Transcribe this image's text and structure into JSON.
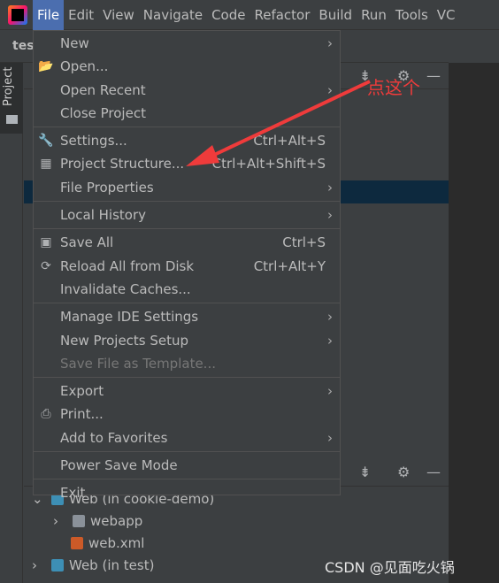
{
  "menubar": {
    "items": [
      "File",
      "Edit",
      "View",
      "Navigate",
      "Code",
      "Refactor",
      "Build",
      "Run",
      "Tools",
      "VC"
    ],
    "active": "File"
  },
  "tab_title": "tes",
  "tool_strip": {
    "label": "Project"
  },
  "file_menu": {
    "groups": [
      [
        {
          "label": "New",
          "submenu": true
        },
        {
          "label": "Open...",
          "icon": "folder-open-icon"
        },
        {
          "label": "Open Recent",
          "submenu": true
        },
        {
          "label": "Close Project"
        }
      ],
      [
        {
          "label": "Settings...",
          "shortcut": "Ctrl+Alt+S",
          "icon": "wrench-icon"
        },
        {
          "label": "Project Structure...",
          "shortcut": "Ctrl+Alt+Shift+S",
          "icon": "project-structure-icon"
        },
        {
          "label": "File Properties",
          "submenu": true
        }
      ],
      [
        {
          "label": "Local History",
          "submenu": true
        }
      ],
      [
        {
          "label": "Save All",
          "shortcut": "Ctrl+S",
          "icon": "save-icon"
        },
        {
          "label": "Reload All from Disk",
          "shortcut": "Ctrl+Alt+Y",
          "icon": "reload-icon"
        },
        {
          "label": "Invalidate Caches..."
        }
      ],
      [
        {
          "label": "Manage IDE Settings",
          "submenu": true
        },
        {
          "label": "New Projects Setup",
          "submenu": true
        },
        {
          "label": "Save File as Template...",
          "disabled": true
        }
      ],
      [
        {
          "label": "Export",
          "submenu": true
        },
        {
          "label": "Print...",
          "icon": "print-icon"
        },
        {
          "label": "Add to Favorites",
          "submenu": true
        }
      ],
      [
        {
          "label": "Power Save Mode"
        }
      ],
      [
        {
          "label": "Exit"
        }
      ]
    ]
  },
  "tree": [
    {
      "label": "Web (in cookie-demo)",
      "expanded": true,
      "icon": "web-module-icon"
    },
    {
      "label": "webapp",
      "expanded": false,
      "icon": "web-folder-icon"
    },
    {
      "label": "web.xml",
      "icon": "xml-file-icon"
    },
    {
      "label": "Web (in test)",
      "expanded": false,
      "icon": "web-module-icon"
    }
  ],
  "annotation": {
    "text": "点这个",
    "color": "#ef3b3b"
  },
  "watermark": "CSDN @见面吃火锅",
  "colors": {
    "accent": "#4b6eaf",
    "menu_bg": "#3c3f41",
    "selection": "#0d293e"
  }
}
